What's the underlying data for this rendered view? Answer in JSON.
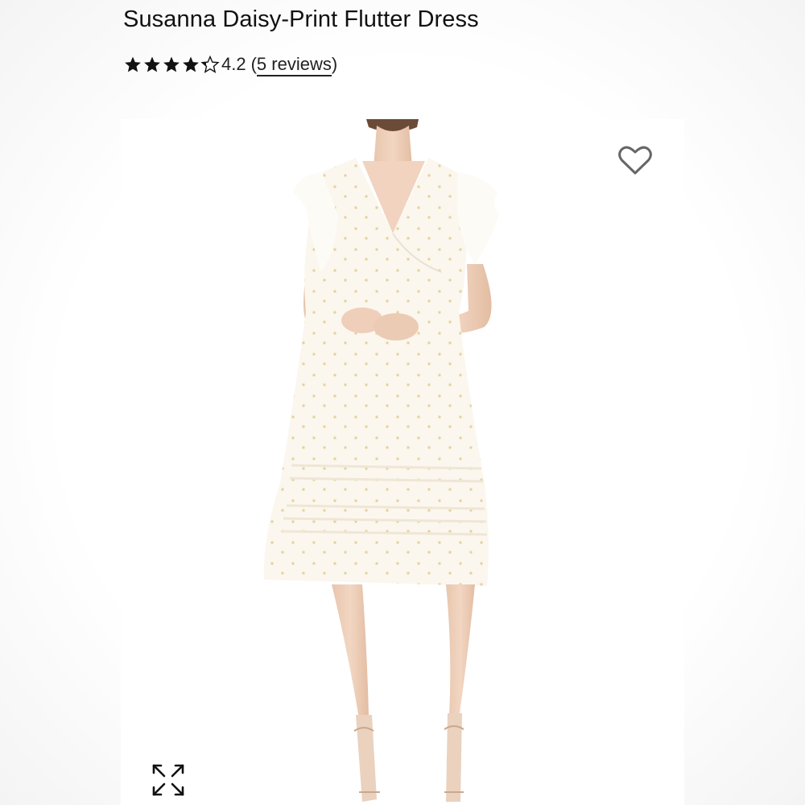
{
  "product": {
    "title": "Susanna Daisy-Print Flutter Dress",
    "rating": {
      "stars_filled": 4.2,
      "stars_total": 5,
      "value_text": "4.2",
      "reviews_open": "(",
      "reviews_link_text": "5 reviews",
      "reviews_close": ")"
    }
  },
  "image": {
    "alt": "Model wearing white daisy-print flutter-sleeve midi dress",
    "background_color": "#ffffff",
    "dress_color": "#fbf7ef",
    "skin_color": "#efd2bd",
    "hair_color": "#6b4a38"
  },
  "icons": {
    "wishlist": "heart-outline-icon",
    "expand": "expand-arrows-icon",
    "star": "star-icon"
  },
  "colors": {
    "text": "#111111",
    "icon": "#666666"
  }
}
